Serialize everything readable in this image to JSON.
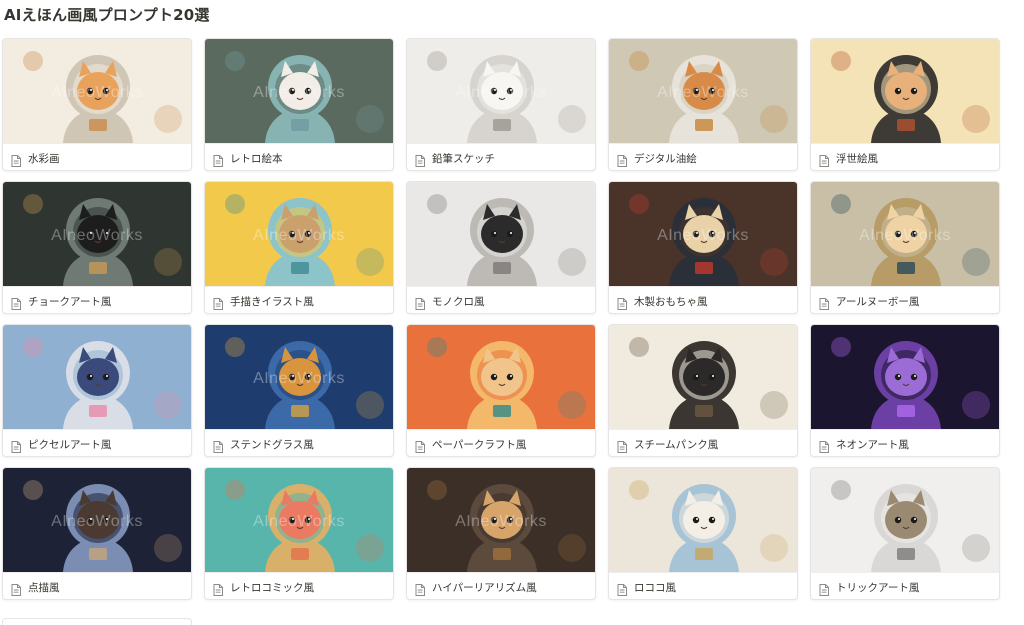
{
  "page": {
    "title": "AIえほん画風プロンプト20選"
  },
  "cards": [
    {
      "label": "水彩画",
      "icon": "document-icon",
      "thumb": {
        "bg": "#f3ece0",
        "accent": "#c98b4a",
        "helmet": "#cfc6b5",
        "cat": "#e8a25c",
        "watermark": "AIneoWorks"
      }
    },
    {
      "label": "レトロ絵本",
      "icon": "document-icon",
      "thumb": {
        "bg": "#5b6a5e",
        "accent": "#6f9aa0",
        "helmet": "#87b3b3",
        "cat": "#f2ede6",
        "watermark": "AIneoWorks"
      }
    },
    {
      "label": "鉛筆スケッチ",
      "icon": "document-icon",
      "thumb": {
        "bg": "#efede9",
        "accent": "#9a9690",
        "helmet": "#d7d4cf",
        "cat": "#f7f6f3",
        "watermark": "AIneoWorks"
      }
    },
    {
      "label": "デジタル油絵",
      "icon": "document-icon",
      "thumb": {
        "bg": "#cfc8b4",
        "accent": "#c48436",
        "helmet": "#e7e3da",
        "cat": "#d88b49",
        "watermark": "AIneoWorks"
      }
    },
    {
      "label": "浮世絵風",
      "icon": "document-icon",
      "thumb": {
        "bg": "#f4e3b6",
        "accent": "#b5522e",
        "helmet": "#3e3b36",
        "cat": "#e8b07a",
        "watermark": ""
      }
    },
    {
      "label": "チョークアート風",
      "icon": "document-icon",
      "thumb": {
        "bg": "#2f3530",
        "accent": "#c89a54",
        "helmet": "#6e7a73",
        "cat": "#1d1d1d",
        "watermark": "AIneoWorks"
      }
    },
    {
      "label": "手描きイラスト風",
      "icon": "document-icon",
      "thumb": {
        "bg": "#f3c94b",
        "accent": "#3e8a93",
        "helmet": "#8cc4c9",
        "cat": "#caa06c",
        "watermark": "AIneoWorks"
      }
    },
    {
      "label": "モノクロ風",
      "icon": "document-icon",
      "thumb": {
        "bg": "#e9e8e6",
        "accent": "#7a7875",
        "helmet": "#bdbab6",
        "cat": "#2b2b2b",
        "watermark": ""
      }
    },
    {
      "label": "木製おもちゃ風",
      "icon": "document-icon",
      "thumb": {
        "bg": "#4a342a",
        "accent": "#c23a2c",
        "helmet": "#2a2f38",
        "cat": "#e9d2a8",
        "watermark": "AIneoWorks"
      }
    },
    {
      "label": "アールヌーボー風",
      "icon": "document-icon",
      "thumb": {
        "bg": "#c9bfa6",
        "accent": "#274a5a",
        "helmet": "#b89c68",
        "cat": "#efd3a4",
        "watermark": "AIneoWorks"
      }
    },
    {
      "label": "ピクセルアート風",
      "icon": "document-icon",
      "thumb": {
        "bg": "#8fb0d0",
        "accent": "#e98ba9",
        "helmet": "#d8dde6",
        "cat": "#3a4a7a",
        "watermark": ""
      }
    },
    {
      "label": "ステンドグラス風",
      "icon": "document-icon",
      "thumb": {
        "bg": "#1f3c6e",
        "accent": "#d7a23c",
        "helmet": "#3c6aa8",
        "cat": "#d9943e",
        "watermark": "AIneoWorks"
      }
    },
    {
      "label": "ペーパークラフト風",
      "icon": "document-icon",
      "thumb": {
        "bg": "#e9713c",
        "accent": "#2e8a8a",
        "helmet": "#f4b86a",
        "cat": "#f0c48a",
        "watermark": ""
      }
    },
    {
      "label": "スチームパンク風",
      "icon": "document-icon",
      "thumb": {
        "bg": "#f1ebdf",
        "accent": "#6d5a41",
        "helmet": "#3b3631",
        "cat": "#2c2a28",
        "watermark": ""
      }
    },
    {
      "label": "ネオンアート風",
      "icon": "document-icon",
      "thumb": {
        "bg": "#1c1530",
        "accent": "#b06af0",
        "helmet": "#6b3fa3",
        "cat": "#9b6cd6",
        "watermark": ""
      }
    },
    {
      "label": "点描風",
      "icon": "document-icon",
      "thumb": {
        "bg": "#1e2236",
        "accent": "#c6a57a",
        "helmet": "#7b8db2",
        "cat": "#4a3a32",
        "watermark": "AIneoWorks"
      }
    },
    {
      "label": "レトロコミック風",
      "icon": "document-icon",
      "thumb": {
        "bg": "#58b5ab",
        "accent": "#e4704e",
        "helmet": "#d9b06a",
        "cat": "#ea7a62",
        "watermark": "AIneoWorks"
      }
    },
    {
      "label": "ハイパーリアリズム風",
      "icon": "document-icon",
      "thumb": {
        "bg": "#3b2f28",
        "accent": "#a0703c",
        "helmet": "#5c4a3c",
        "cat": "#d7a46a",
        "watermark": "AIneoWorks"
      }
    },
    {
      "label": "ロココ風",
      "icon": "document-icon",
      "thumb": {
        "bg": "#ece6da",
        "accent": "#c9a45a",
        "helmet": "#a7c3d6",
        "cat": "#f4efe6",
        "watermark": ""
      }
    },
    {
      "label": "トリックアート風",
      "icon": "document-icon",
      "thumb": {
        "bg": "#f0efed",
        "accent": "#7b7a78",
        "helmet": "#d9d8d6",
        "cat": "#9b8a72",
        "watermark": ""
      }
    }
  ]
}
